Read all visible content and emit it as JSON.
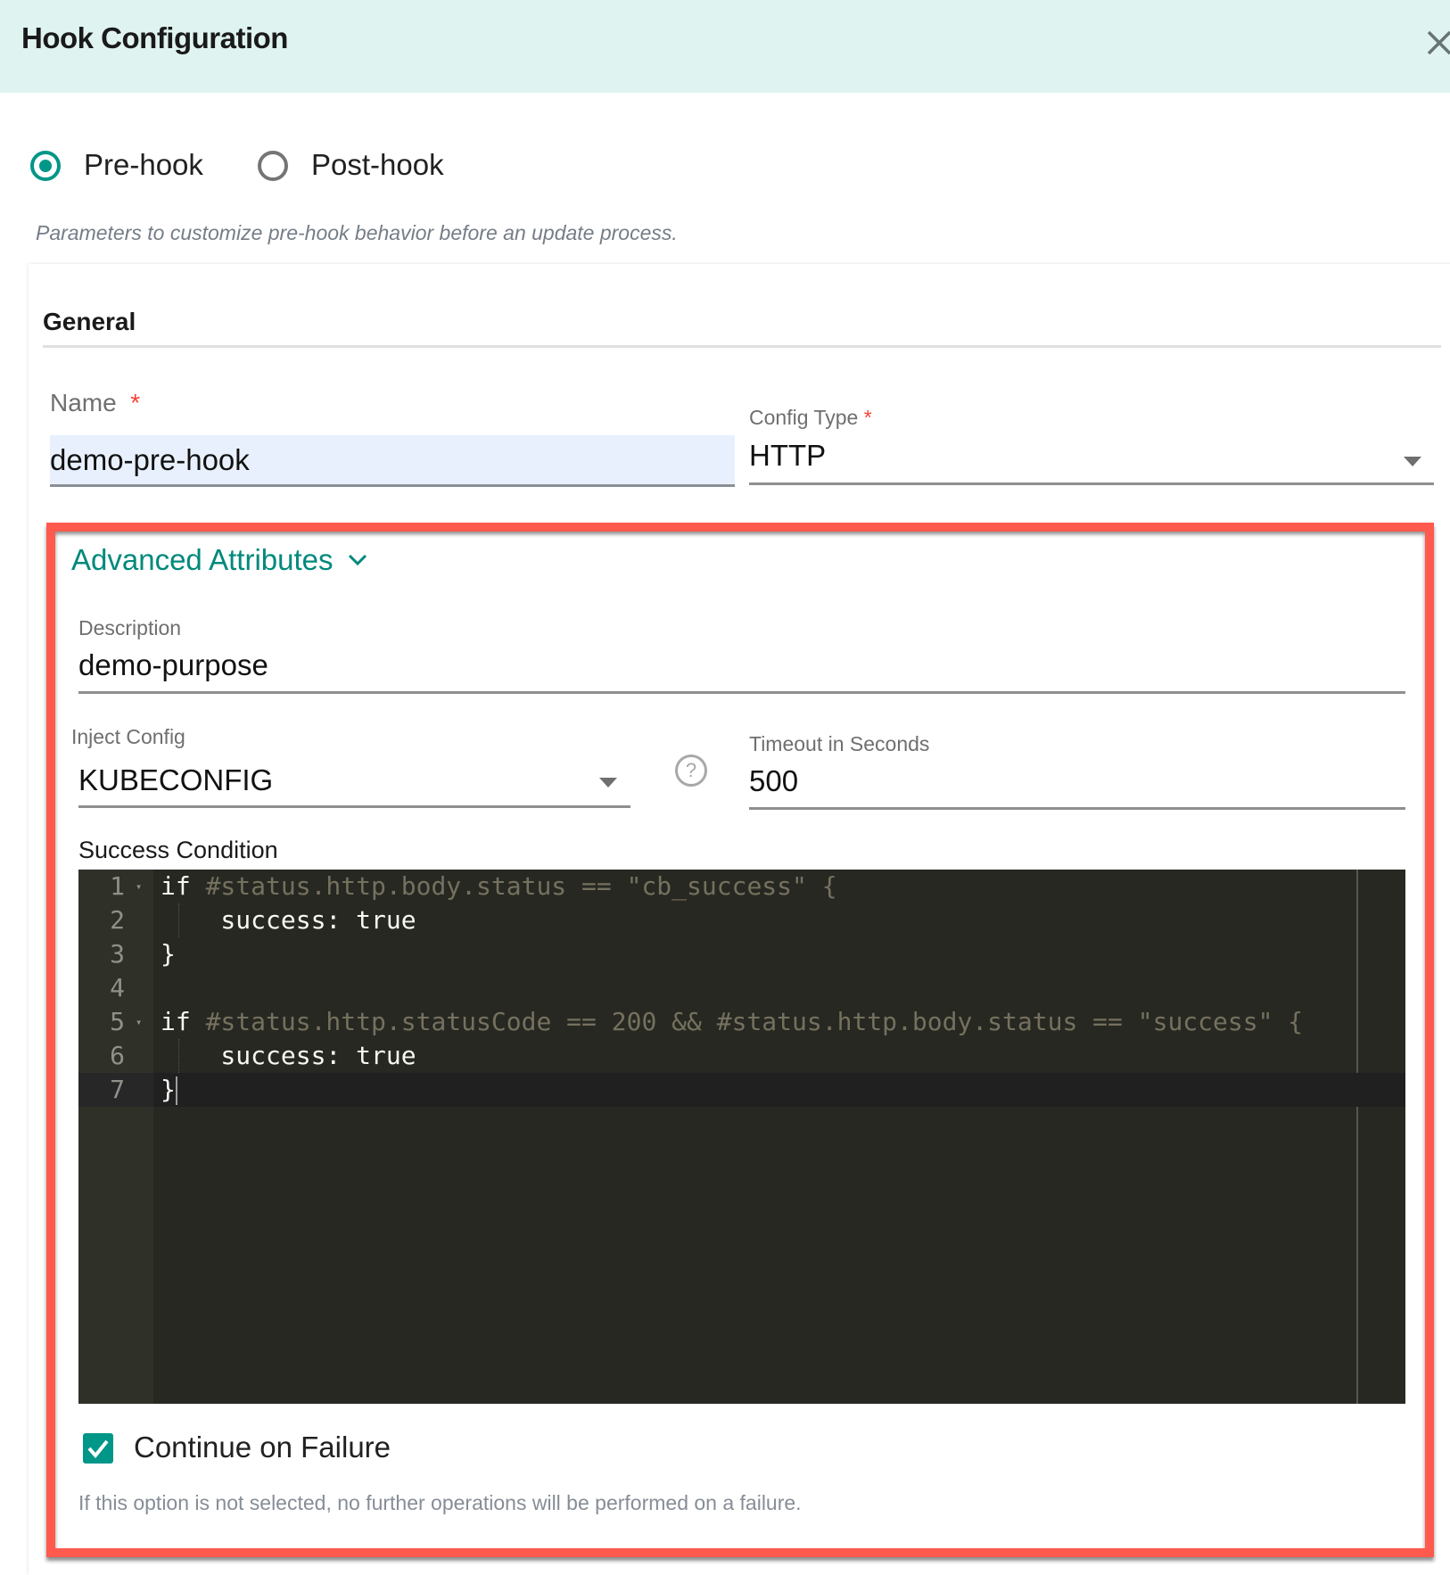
{
  "header": {
    "title": "Hook Configuration",
    "close_icon": "close-icon"
  },
  "hook_type": {
    "options": [
      {
        "label": "Pre-hook",
        "selected": true
      },
      {
        "label": "Post-hook",
        "selected": false
      }
    ],
    "description": "Parameters to customize pre-hook behavior before an update process."
  },
  "general": {
    "title": "General",
    "name": {
      "label": "Name",
      "required_marker": "*",
      "value": "demo-pre-hook"
    },
    "config_type": {
      "label": "Config Type",
      "required_marker": "*",
      "value": "HTTP"
    }
  },
  "advanced": {
    "title": "Advanced Attributes",
    "expand_icon": "chevron-down-icon",
    "description": {
      "label": "Description",
      "value": "demo-purpose"
    },
    "inject_config": {
      "label": "Inject Config",
      "value": "KUBECONFIG",
      "help_icon": "?"
    },
    "timeout": {
      "label": "Timeout in Seconds",
      "value": "500"
    },
    "success_condition": {
      "label": "Success Condition",
      "lines": [
        {
          "num": "1",
          "fold": "▾",
          "kw": "if",
          "rest": " #status.http.body.status == \"cb_success\" {"
        },
        {
          "num": "2",
          "fold": "",
          "kw": "",
          "rest": "    success: true"
        },
        {
          "num": "3",
          "fold": "",
          "kw": "",
          "rest": "}"
        },
        {
          "num": "4",
          "fold": "",
          "kw": "",
          "rest": ""
        },
        {
          "num": "5",
          "fold": "▾",
          "kw": "if",
          "rest": " #status.http.statusCode == 200 && #status.http.body.status == \"success\" {"
        },
        {
          "num": "6",
          "fold": "",
          "kw": "",
          "rest": "    success: true"
        },
        {
          "num": "7",
          "fold": "",
          "kw": "",
          "rest": "}"
        }
      ]
    },
    "continue_on_failure": {
      "label": "Continue on Failure",
      "checked": true,
      "helper": "If this option is not selected, no further operations will be performed on a failure."
    }
  },
  "colors": {
    "accent": "#009688",
    "header_bg": "#dff4f1",
    "highlight_border": "#ff5a4d",
    "editor_bg": "#272822"
  }
}
